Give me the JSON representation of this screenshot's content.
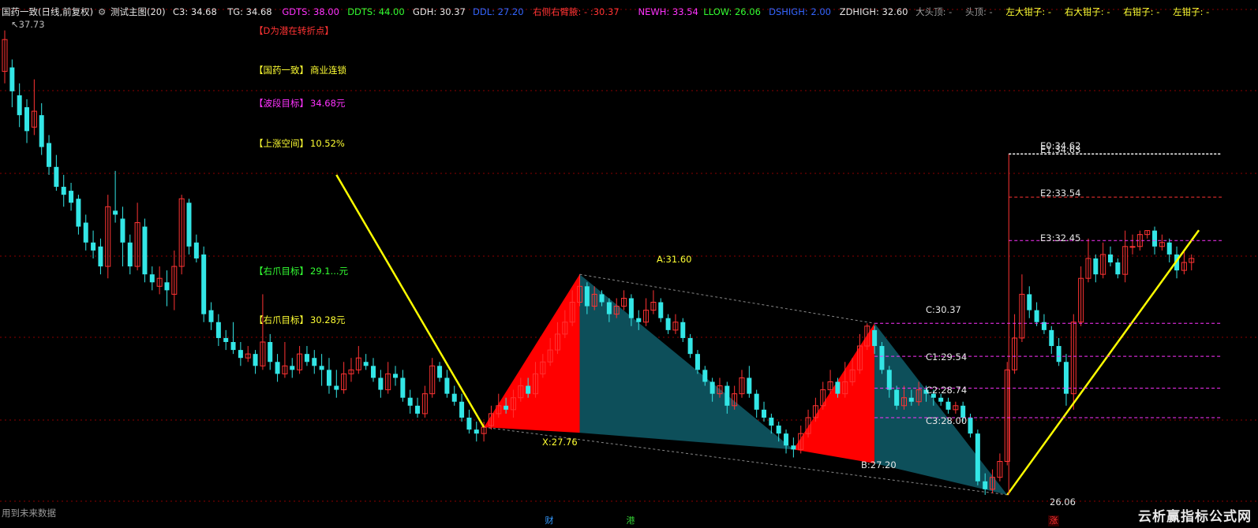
{
  "header": {
    "title": "国药一致(日线,前复权)",
    "indicator_name": "测试主图(20)",
    "fields": [
      {
        "label": "C3:",
        "value": "34.68",
        "color": "#e6e6e6"
      },
      {
        "label": "TG:",
        "value": "34.68",
        "color": "#e6e6e6"
      },
      {
        "label": "GDTS:",
        "value": "38.00",
        "color": "#ff33ff"
      },
      {
        "label": "DDTS:",
        "value": "44.00",
        "color": "#33ff33"
      },
      {
        "label": "GDH:",
        "value": "30.37",
        "color": "#e6e6e6"
      },
      {
        "label": "DDL:",
        "value": "27.20",
        "color": "#3366ff"
      },
      {
        "label": "右侧右臂腋:",
        "value": "- :30.37",
        "color": "#ff3333"
      },
      {
        "label": "NEWH:",
        "value": "33.54",
        "color": "#ff33ff"
      },
      {
        "label": "LLOW:",
        "value": "26.06",
        "color": "#33ff33"
      },
      {
        "label": "DSHIGH:",
        "value": "2.00",
        "color": "#3366ff"
      },
      {
        "label": "ZDHIGH:",
        "value": "32.60",
        "color": "#e6e6e6"
      },
      {
        "label": "大头顶:",
        "value": "-",
        "color": "#9a9a9a"
      },
      {
        "label": "头顶:",
        "value": "-",
        "color": "#9a9a9a"
      },
      {
        "label": "左大钳子:",
        "value": "-",
        "color": "#ffff33"
      },
      {
        "label": "右大钳子:",
        "value": "-",
        "color": "#ffff33"
      },
      {
        "label": "右钳子:",
        "value": "-",
        "color": "#ffff33"
      },
      {
        "label": "左钳子:",
        "value": "-",
        "color": "#ffff33"
      }
    ],
    "max_price": "37.73"
  },
  "info_panel": [
    {
      "label": "【D为潜在转折点】",
      "value": "",
      "label_color": "#ff3333",
      "value_color": "#ff3333"
    },
    {
      "label": "【国药一致】",
      "value": "商业连锁",
      "label_color": "#ffff33",
      "value_color": "#ffff33"
    },
    {
      "label": "【波段目标】",
      "value": "34.68元",
      "label_color": "#ff33ff",
      "value_color": "#ff33ff"
    },
    {
      "label": "【上涨空间】",
      "value": "10.52%",
      "label_color": "#ffff33",
      "value_color": "#ffff33"
    },
    {
      "label": "【右爪目标】",
      "value": "29.1...元",
      "label_color": "#33ff33",
      "value_color": "#33ff33"
    },
    {
      "label": "【右爪目标】",
      "value": "30.28元",
      "label_color": "#ffff33",
      "value_color": "#ffff33"
    }
  ],
  "pattern_points": {
    "X": "X:27.76",
    "A": "A:31.60",
    "B": "B:27.20",
    "C": "C:30.37",
    "D": "26.06"
  },
  "levels": {
    "E0": "E0:34.62",
    "E1": "E1:34.63",
    "E2": "E2:33.54",
    "E3": "E3:32.45",
    "C1": "C1:29.54",
    "C2": "C2:28.74",
    "C3": "C3:28.00"
  },
  "footer": {
    "future_data": "用到未来数据",
    "marker_cai": "财",
    "marker_gang": "港",
    "marker_zhang": "涨",
    "watermark": "云析赢指标公式网"
  },
  "colors": {
    "up": "#ff3333",
    "down": "#33e6e6",
    "triangle_red": "#ff0000",
    "triangle_teal": "#0d4f5a",
    "trend": "#ffff00",
    "grid": "#8b0000"
  },
  "chart_data": {
    "type": "candlestick",
    "price_range": [
      25.9,
      37.9
    ],
    "candles": [
      [
        36.7,
        37.5,
        37.73,
        36.4
      ],
      [
        36.8,
        36.2,
        37.0,
        35.8
      ],
      [
        36.1,
        35.6,
        36.4,
        35.3
      ],
      [
        35.8,
        35.2,
        36.0,
        34.9
      ],
      [
        35.3,
        35.7,
        36.5,
        35.1
      ],
      [
        35.6,
        34.8,
        35.9,
        34.6
      ],
      [
        34.9,
        34.3,
        35.1,
        34.1
      ],
      [
        34.3,
        33.8,
        34.6,
        33.7
      ],
      [
        33.8,
        33.6,
        34.1,
        33.3
      ],
      [
        33.7,
        33.4,
        33.9,
        33.2
      ],
      [
        33.5,
        32.8,
        33.6,
        32.6
      ],
      [
        32.9,
        32.4,
        33.1,
        32.2
      ],
      [
        32.4,
        32.2,
        32.7,
        32.0
      ],
      [
        32.3,
        31.8,
        32.5,
        31.6
      ],
      [
        31.8,
        33.3,
        33.6,
        31.5
      ],
      [
        33.2,
        33.1,
        34.2,
        32.9
      ],
      [
        33.0,
        32.4,
        33.3,
        31.8
      ],
      [
        32.4,
        31.8,
        32.6,
        31.6
      ],
      [
        31.8,
        32.9,
        33.4,
        31.7
      ],
      [
        32.8,
        31.6,
        33.0,
        31.4
      ],
      [
        31.6,
        31.4,
        31.8,
        31.2
      ],
      [
        31.3,
        31.5,
        31.8,
        31.1
      ],
      [
        31.4,
        31.2,
        31.7,
        30.8
      ],
      [
        31.1,
        31.8,
        32.2,
        30.7
      ],
      [
        31.8,
        33.5,
        33.6,
        31.6
      ],
      [
        33.4,
        32.3,
        33.5,
        32.1
      ],
      [
        32.4,
        32.0,
        32.6,
        31.9
      ],
      [
        32.1,
        30.6,
        32.3,
        30.4
      ],
      [
        30.7,
        30.4,
        30.9,
        30.2
      ],
      [
        30.4,
        30.0,
        30.6,
        29.8
      ],
      [
        30.0,
        29.9,
        30.2,
        29.7
      ],
      [
        29.9,
        29.7,
        30.4,
        29.6
      ],
      [
        29.7,
        29.5,
        29.9,
        29.3
      ],
      [
        29.5,
        29.6,
        29.8,
        29.4
      ],
      [
        29.6,
        29.3,
        29.7,
        29.1
      ],
      [
        29.3,
        29.9,
        31.1,
        29.2
      ],
      [
        29.9,
        29.4,
        30.1,
        29.2
      ],
      [
        29.4,
        29.1,
        29.6,
        28.9
      ],
      [
        29.1,
        29.3,
        29.9,
        29.0
      ],
      [
        29.3,
        29.2,
        29.5,
        29.0
      ],
      [
        29.2,
        29.6,
        29.8,
        29.1
      ],
      [
        29.6,
        29.4,
        29.8,
        29.3
      ],
      [
        29.5,
        29.3,
        29.7,
        29.1
      ],
      [
        29.3,
        29.2,
        29.6,
        28.8
      ],
      [
        29.2,
        28.8,
        29.5,
        28.6
      ],
      [
        28.8,
        28.7,
        29.2,
        28.5
      ],
      [
        28.7,
        29.1,
        29.4,
        28.6
      ],
      [
        29.1,
        29.2,
        29.5,
        28.9
      ],
      [
        29.2,
        29.5,
        29.8,
        29.1
      ],
      [
        29.4,
        29.3,
        29.6,
        29.2
      ],
      [
        29.3,
        29.0,
        29.5,
        28.9
      ],
      [
        29.0,
        28.7,
        29.2,
        28.5
      ],
      [
        28.7,
        29.1,
        29.4,
        28.6
      ],
      [
        29.1,
        29.0,
        29.3,
        28.8
      ],
      [
        29.0,
        28.5,
        29.2,
        28.4
      ],
      [
        28.5,
        28.3,
        28.7,
        28.1
      ],
      [
        28.3,
        28.1,
        28.5,
        28.0
      ],
      [
        28.1,
        28.6,
        28.8,
        28.0
      ],
      [
        28.6,
        29.3,
        29.5,
        28.5
      ],
      [
        29.3,
        29.0,
        29.4,
        28.9
      ],
      [
        29.0,
        28.6,
        29.2,
        28.5
      ],
      [
        28.6,
        28.4,
        28.8,
        28.3
      ],
      [
        28.4,
        28.0,
        28.6,
        27.9
      ],
      [
        28.0,
        27.7,
        28.2,
        27.6
      ],
      [
        27.7,
        27.6,
        27.9,
        27.4
      ],
      [
        27.6,
        27.76,
        27.9,
        27.4
      ],
      [
        27.8,
        28.1,
        28.3,
        27.7
      ],
      [
        28.1,
        28.3,
        28.6,
        28.0
      ],
      [
        28.3,
        28.2,
        28.5,
        28.1
      ],
      [
        28.2,
        28.5,
        28.7,
        28.0
      ],
      [
        28.5,
        28.8,
        29.0,
        28.4
      ],
      [
        28.8,
        28.6,
        29.0,
        28.5
      ],
      [
        28.6,
        29.1,
        29.4,
        28.5
      ],
      [
        29.1,
        29.4,
        29.6,
        29.0
      ],
      [
        29.4,
        29.7,
        30.0,
        29.3
      ],
      [
        29.7,
        30.1,
        30.4,
        29.6
      ],
      [
        30.1,
        30.4,
        30.7,
        30.0
      ],
      [
        30.4,
        30.9,
        31.2,
        30.3
      ],
      [
        30.9,
        31.3,
        31.6,
        30.8
      ],
      [
        31.3,
        30.8,
        31.4,
        30.6
      ],
      [
        30.8,
        31.1,
        31.3,
        30.7
      ],
      [
        31.1,
        30.9,
        31.2,
        30.8
      ],
      [
        30.9,
        30.6,
        31.0,
        30.4
      ],
      [
        30.6,
        30.8,
        31.0,
        30.5
      ],
      [
        30.8,
        31.0,
        31.2,
        30.7
      ],
      [
        31.0,
        30.5,
        31.1,
        30.3
      ],
      [
        30.5,
        30.4,
        30.7,
        30.2
      ],
      [
        30.4,
        30.7,
        31.0,
        30.3
      ],
      [
        30.7,
        30.9,
        31.2,
        30.6
      ],
      [
        30.9,
        30.5,
        31.0,
        30.4
      ],
      [
        30.5,
        30.2,
        30.6,
        30.1
      ],
      [
        30.2,
        30.4,
        30.6,
        30.1
      ],
      [
        30.4,
        30.0,
        30.5,
        29.9
      ],
      [
        30.0,
        29.6,
        30.1,
        29.5
      ],
      [
        29.6,
        29.2,
        29.7,
        29.1
      ],
      [
        29.2,
        28.9,
        29.3,
        28.8
      ],
      [
        28.9,
        28.6,
        29.0,
        28.4
      ],
      [
        28.6,
        28.8,
        29.0,
        28.5
      ],
      [
        28.8,
        28.3,
        28.9,
        28.1
      ],
      [
        28.3,
        28.6,
        28.8,
        28.2
      ],
      [
        28.6,
        29.0,
        29.2,
        28.5
      ],
      [
        29.0,
        28.6,
        29.3,
        28.5
      ],
      [
        28.6,
        28.2,
        28.7,
        28.0
      ],
      [
        28.2,
        28.0,
        28.4,
        27.9
      ],
      [
        28.0,
        27.8,
        28.1,
        27.6
      ],
      [
        27.8,
        27.6,
        27.9,
        27.4
      ],
      [
        27.6,
        27.3,
        27.7,
        27.1
      ],
      [
        27.3,
        27.2,
        27.5,
        27.0
      ],
      [
        27.2,
        27.6,
        27.8,
        27.1
      ],
      [
        27.6,
        28.0,
        28.2,
        27.5
      ],
      [
        28.0,
        28.3,
        28.5,
        27.9
      ],
      [
        28.3,
        28.7,
        28.9,
        28.2
      ],
      [
        28.7,
        28.9,
        29.2,
        28.6
      ],
      [
        28.9,
        28.6,
        29.0,
        28.5
      ],
      [
        28.6,
        28.9,
        29.4,
        28.5
      ],
      [
        28.9,
        29.2,
        29.5,
        28.8
      ],
      [
        29.2,
        29.8,
        30.1,
        29.1
      ],
      [
        29.8,
        30.3,
        30.37,
        29.7
      ],
      [
        30.2,
        29.8,
        30.3,
        29.6
      ],
      [
        29.8,
        29.2,
        29.9,
        29.1
      ],
      [
        29.2,
        28.7,
        29.3,
        28.5
      ],
      [
        28.7,
        28.3,
        28.8,
        28.2
      ],
      [
        28.3,
        28.5,
        28.8,
        28.2
      ],
      [
        28.5,
        28.4,
        28.7,
        28.3
      ],
      [
        28.4,
        28.7,
        28.9,
        28.3
      ],
      [
        28.7,
        28.6,
        28.8,
        28.4
      ],
      [
        28.6,
        28.5,
        28.7,
        28.3
      ],
      [
        28.5,
        28.4,
        28.6,
        28.3
      ],
      [
        28.4,
        28.2,
        28.5,
        28.1
      ],
      [
        28.2,
        28.3,
        28.4,
        28.1
      ],
      [
        28.3,
        28.0,
        28.4,
        27.9
      ],
      [
        28.0,
        27.6,
        28.1,
        27.5
      ],
      [
        27.6,
        26.4,
        27.7,
        26.3
      ],
      [
        26.4,
        26.2,
        26.6,
        26.06
      ],
      [
        26.2,
        26.5,
        26.7,
        26.1
      ],
      [
        26.5,
        26.9,
        27.1,
        26.4
      ],
      [
        26.9,
        29.2,
        29.4,
        26.8
      ],
      [
        29.2,
        30.0,
        30.6,
        29.1
      ],
      [
        30.0,
        31.1,
        31.6,
        29.9
      ],
      [
        31.1,
        30.7,
        31.3,
        30.5
      ],
      [
        30.7,
        30.4,
        30.9,
        30.3
      ],
      [
        30.4,
        30.2,
        30.6,
        30.1
      ],
      [
        30.2,
        29.8,
        30.3,
        29.6
      ],
      [
        29.8,
        29.4,
        30.0,
        29.3
      ],
      [
        29.4,
        28.6,
        29.6,
        28.3
      ],
      [
        28.6,
        30.4,
        30.6,
        28.2
      ],
      [
        30.4,
        31.5,
        31.8,
        30.3
      ],
      [
        31.5,
        32.0,
        32.5,
        31.4
      ],
      [
        32.0,
        31.6,
        32.1,
        31.4
      ],
      [
        31.6,
        32.1,
        32.4,
        31.5
      ],
      [
        32.1,
        31.9,
        32.3,
        31.8
      ],
      [
        31.9,
        31.6,
        32.0,
        31.5
      ],
      [
        31.6,
        32.3,
        32.7,
        31.4
      ],
      [
        32.3,
        32.3,
        32.6,
        32.1
      ],
      [
        32.3,
        32.6,
        32.7,
        32.2
      ],
      [
        32.6,
        32.7,
        32.71,
        32.5
      ],
      [
        32.7,
        32.3,
        32.8,
        32.1
      ],
      [
        32.3,
        32.4,
        32.6,
        32.2
      ],
      [
        32.4,
        32.1,
        32.5,
        31.9
      ],
      [
        32.1,
        31.7,
        32.3,
        31.5
      ],
      [
        31.7,
        31.9,
        32.2,
        31.6
      ],
      [
        31.9,
        32.0,
        32.1,
        31.7
      ]
    ]
  }
}
